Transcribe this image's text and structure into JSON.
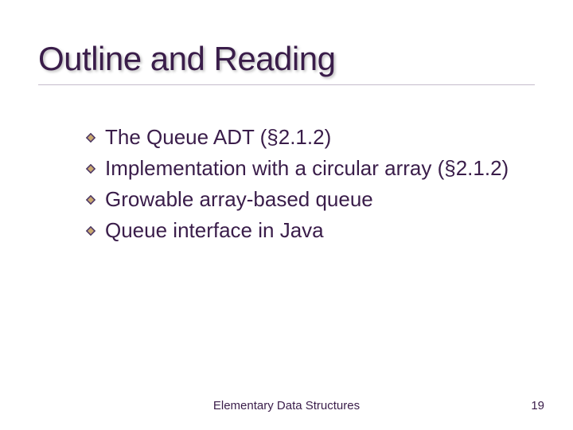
{
  "title": "Outline and Reading",
  "bullets": [
    "The Queue ADT (§2.1.2)",
    "Implementation with a circular array (§2.1.2)",
    "Growable array-based queue",
    "Queue interface in Java"
  ],
  "footer": "Elementary Data Structures",
  "page_number": "19"
}
